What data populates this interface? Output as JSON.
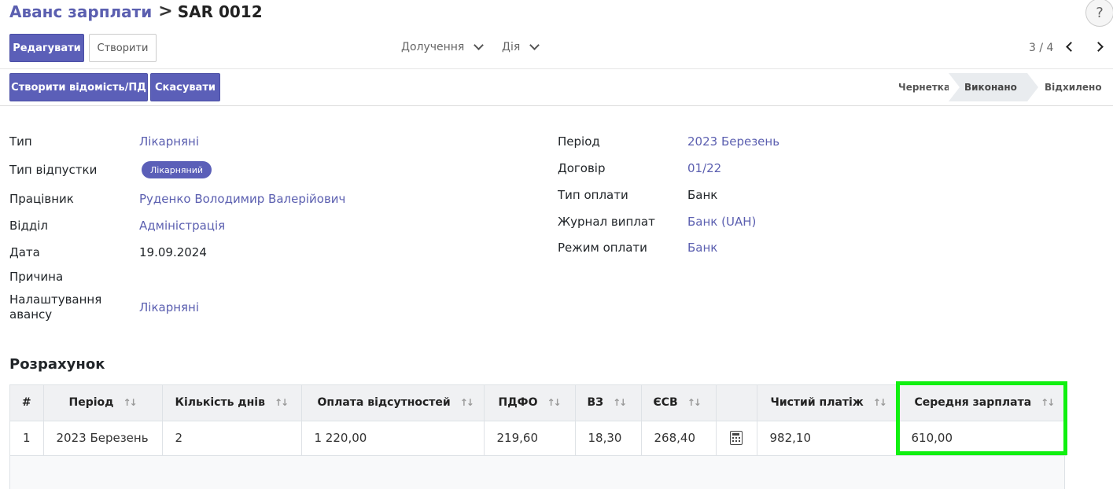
{
  "breadcrumb": {
    "parent": "Аванс зарплати",
    "separator": ">",
    "current": "SAR 0012"
  },
  "help": "?",
  "toolbar": {
    "edit": "Редагувати",
    "create": "Створити",
    "attachments": "Долучення",
    "action": "Дія",
    "pager": "3 / 4"
  },
  "actions": {
    "create_statement": "Створити відомість/ПД",
    "cancel": "Скасувати"
  },
  "stages": [
    {
      "label": "Чернетка",
      "active": false
    },
    {
      "label": "Виконано",
      "active": true
    },
    {
      "label": "Відхилено",
      "active": false
    }
  ],
  "form": {
    "left": [
      {
        "label": "Тип",
        "value": "Лікарняні"
      },
      {
        "label": "Тип відпустки",
        "value": "Лікарняний"
      },
      {
        "label": "Працівник",
        "value": "Руденко Володимир Валерійович"
      },
      {
        "label": "Відділ",
        "value": "Адміністрація"
      },
      {
        "label": "Дата",
        "value": "19.09.2024"
      },
      {
        "label": "Причина",
        "value": ""
      },
      {
        "label": "Налаштування",
        "label2": "авансу",
        "value": "Лікарняні"
      }
    ],
    "right": [
      {
        "label": "Період",
        "value": "2023 Березень"
      },
      {
        "label": "Договір",
        "value": "01/22"
      },
      {
        "label": "Тип оплати",
        "value": "Банк"
      },
      {
        "label": "Журнал виплат",
        "value": "Банк (UAH)"
      },
      {
        "label": "Режим оплати",
        "value": "Банк"
      }
    ]
  },
  "section_title": "Розрахунок",
  "table": {
    "headers": [
      "#",
      "Період",
      "Кількість днів",
      "Оплата відсутностей",
      "ПДФО",
      "ВЗ",
      "ЄСВ",
      "",
      "Чистий платіж",
      "Середня зарплата"
    ],
    "rows": [
      [
        "1",
        "2023 Березень",
        "2",
        "1 220,00",
        "219,60",
        "18,30",
        "268,40",
        "",
        "982,10",
        "610,00"
      ]
    ]
  },
  "colors": {
    "accent": "#5b5fb8",
    "highlight": "#10f010"
  }
}
